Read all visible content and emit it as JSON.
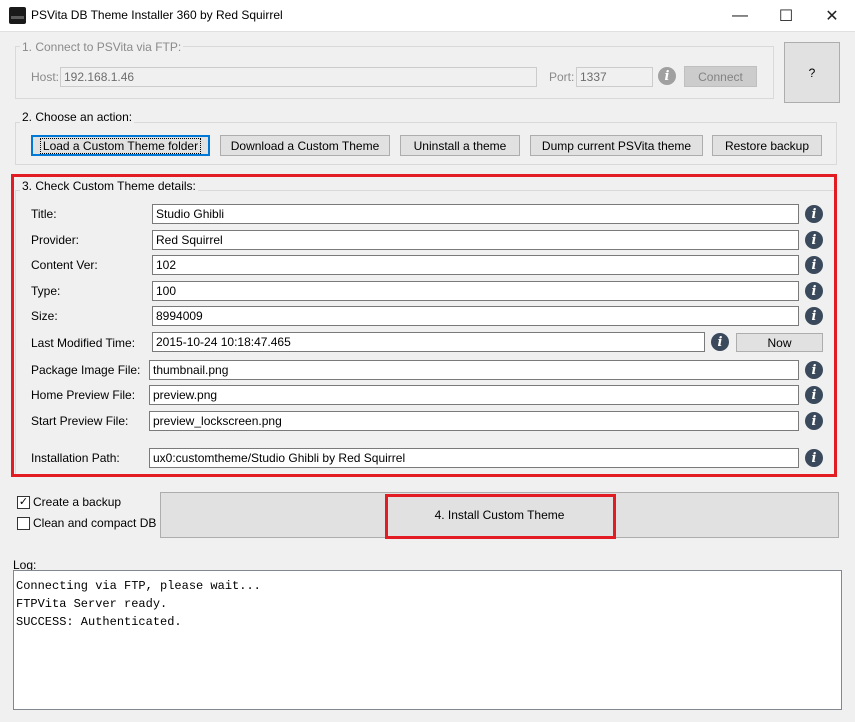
{
  "window": {
    "title": "PSVita DB Theme Installer 360 by Red Squirrel",
    "minimize": "—",
    "maximize": "☐",
    "close": "✕"
  },
  "ftp": {
    "group_label": "1. Connect to PSVita via FTP:",
    "host_label": "Host:",
    "host_value": "192.168.1.46",
    "port_label": "Port:",
    "port_value": "1337",
    "connect_label": "Connect",
    "help_label": "?"
  },
  "actions": {
    "group_label": "2. Choose an action:",
    "buttons": [
      "Load a Custom Theme folder",
      "Download a Custom Theme",
      "Uninstall a theme",
      "Dump current PSVita theme",
      "Restore backup"
    ]
  },
  "details": {
    "group_label": "3. Check Custom Theme details:",
    "fields": [
      {
        "label": "Title:",
        "value": "Studio Ghibli"
      },
      {
        "label": "Provider:",
        "value": "Red Squirrel"
      },
      {
        "label": "Content Ver:",
        "value": "102"
      },
      {
        "label": "Type:",
        "value": "100"
      },
      {
        "label": "Size:",
        "value": "8994009"
      },
      {
        "label": "Last Modified Time:",
        "value": "2015-10-24  10:18:47.465"
      },
      {
        "label": "Package Image File:",
        "value": "thumbnail.png"
      },
      {
        "label": "Home Preview File:",
        "value": "preview.png"
      },
      {
        "label": "Start Preview File:",
        "value": "preview_lockscreen.png"
      },
      {
        "label": "Installation Path:",
        "value": "ux0:customtheme/Studio Ghibli by Red Squirrel"
      }
    ],
    "now_label": "Now",
    "info_glyph": "i"
  },
  "options": {
    "create_backup": {
      "label": "Create a backup",
      "checked": true,
      "mark": "✓"
    },
    "clean_db": {
      "label": "Clean and compact DB",
      "checked": false,
      "mark": ""
    }
  },
  "install": {
    "label": "4. Install Custom Theme"
  },
  "log": {
    "label": "Log:",
    "lines": [
      "Connecting via FTP, please wait...",
      "FTPVita Server ready.",
      "SUCCESS: Authenticated."
    ]
  },
  "colors": {
    "highlight": "#e31b23",
    "info_icon": "#3a4a5c",
    "focus": "#0078d7"
  }
}
